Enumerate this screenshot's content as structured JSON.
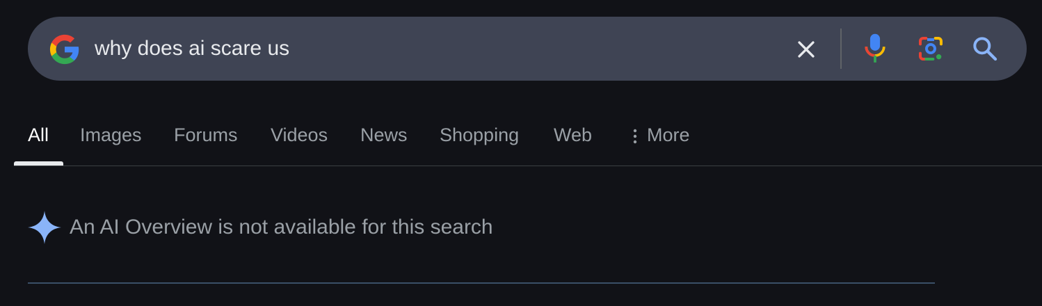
{
  "search": {
    "query": "why does ai scare us",
    "icons": {
      "logo": "google-g-icon",
      "clear": "close-icon",
      "voice": "microphone-icon",
      "lens": "camera-lens-icon",
      "submit": "search-icon"
    }
  },
  "tabs": [
    {
      "label": "All",
      "active": true
    },
    {
      "label": "Images"
    },
    {
      "label": "Forums"
    },
    {
      "label": "Videos"
    },
    {
      "label": "News"
    },
    {
      "label": "Shopping"
    },
    {
      "label": "Web"
    },
    {
      "label": "More",
      "icon": "vertical-dots-icon"
    }
  ],
  "ai_overview": {
    "icon": "sparkle-icon",
    "message": "An AI Overview is not available for this search"
  },
  "colors": {
    "background": "#111217",
    "searchbar": "#3f4454",
    "active_tab": "#ffffff",
    "inactive_tab": "#9aa0a6",
    "sparkle": "#8ab4f8"
  }
}
